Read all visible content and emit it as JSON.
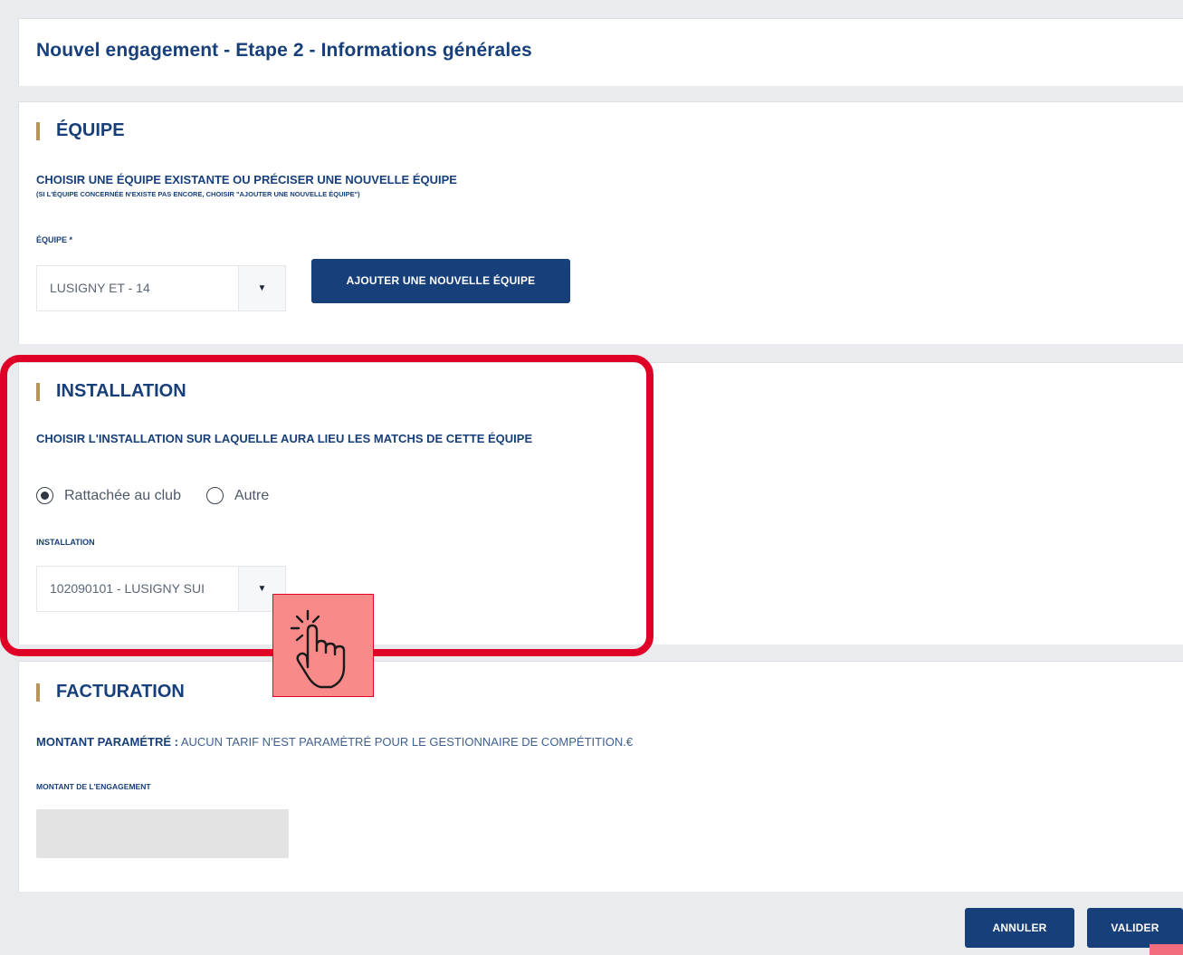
{
  "header": {
    "title": "Nouvel engagement - Etape 2 - Informations générales"
  },
  "equipe": {
    "section_title": "ÉQUIPE",
    "instruction": "CHOISIR UNE ÉQUIPE EXISTANTE OU PRÉCISER UNE NOUVELLE ÉQUIPE",
    "note": "(SI L'ÉQUIPE CONCERNÉE N'EXISTE PAS ENCORE, CHOISIR \"AJOUTER UNE NOUVELLE ÉQUIPE\")",
    "field_label": "ÉQUIPE *",
    "selected_value": "LUSIGNY ET - 14",
    "arrow": "▼",
    "add_button": "AJOUTER UNE NOUVELLE ÉQUIPE"
  },
  "installation": {
    "section_title": "INSTALLATION",
    "instruction": "CHOISIR L'INSTALLATION SUR LAQUELLE AURA LIEU LES MATCHS DE CETTE ÉQUIPE",
    "radio_options": [
      {
        "label": "Rattachée au club",
        "checked": true
      },
      {
        "label": "Autre",
        "checked": false
      }
    ],
    "field_label": "INSTALLATION",
    "selected_value": "102090101 - LUSIGNY SUI",
    "arrow": "▼"
  },
  "facturation": {
    "section_title": "FACTURATION",
    "amount_label": "MONTANT PARAMÉTRÉ :",
    "amount_text": " AUCUN TARIF N'EST PARAMÈTRÉ POUR LE GESTIONNAIRE DE COMPÉTITION.€",
    "engagement_label": "MONTANT DE L'ENGAGEMENT",
    "engagement_value": ""
  },
  "footer": {
    "cancel_label": "ANNULER",
    "submit_label": "VALIDER"
  },
  "colors": {
    "primary": "#173f7a",
    "accent_bar": "#b8935a",
    "highlight": "#e00027",
    "background": "#e9ebee"
  },
  "icons": {
    "pointer": "hand-pointer-click-icon",
    "dropdown": "triangle-down-icon"
  }
}
